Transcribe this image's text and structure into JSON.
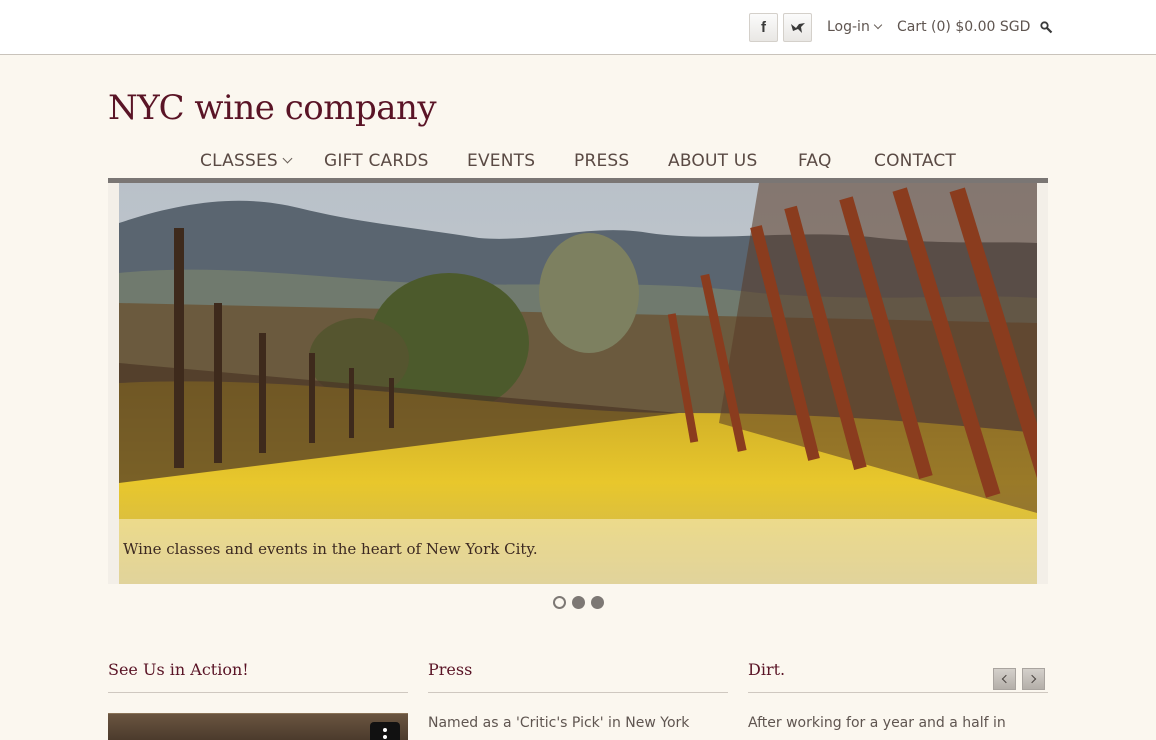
{
  "topbar": {
    "facebook_icon": "facebook-icon",
    "twitter_icon": "twitter-icon",
    "facebook_glyph": "f",
    "twitter_glyph": "🐦",
    "login_label": "Log-in",
    "cart_label": "Cart (0) $0.00 SGD",
    "search_icon": "search-icon"
  },
  "brand": {
    "name": "NYC wine company"
  },
  "nav": {
    "items": [
      {
        "label": "CLASSES",
        "has_dropdown": true
      },
      {
        "label": "GIFT CARDS"
      },
      {
        "label": "EVENTS"
      },
      {
        "label": "PRESS"
      },
      {
        "label": "ABOUT US"
      },
      {
        "label": "FAQ"
      },
      {
        "label": "CONTACT"
      }
    ]
  },
  "hero": {
    "caption": "Wine classes and events in the heart of New York City.",
    "slide_count": 3,
    "active_slide": 1
  },
  "sections": {
    "video": {
      "title": "See Us in Action!"
    },
    "press": {
      "title": "Press",
      "text": "Named as a 'Critic's Pick' in New York"
    },
    "dirt": {
      "title": "Dirt.",
      "text": "After working for a year and a half in"
    }
  },
  "colors": {
    "brand": "#5a1426",
    "background": "#fbf7ef",
    "nav_rule": "#7a7674"
  }
}
